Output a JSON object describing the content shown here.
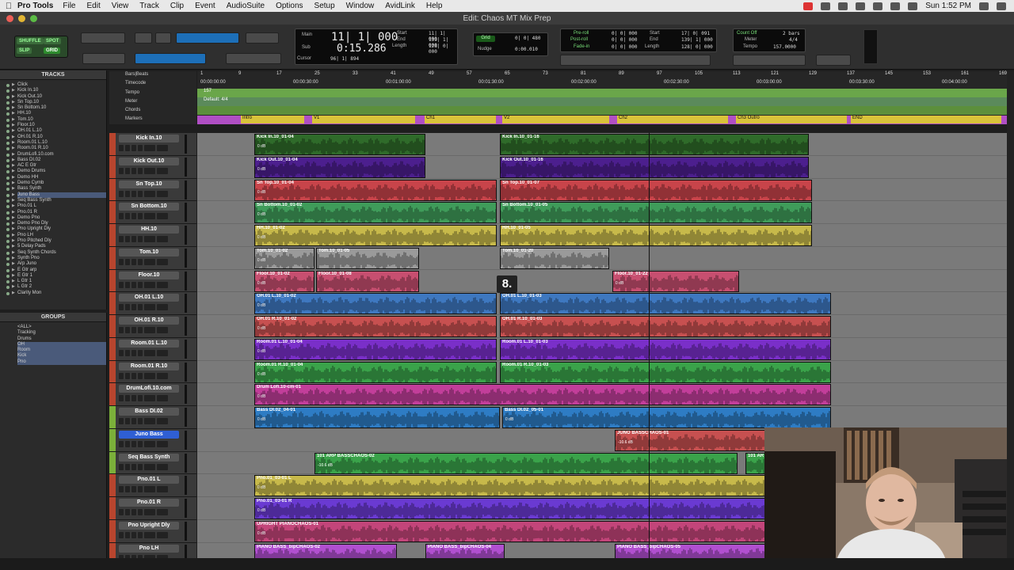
{
  "menubar": {
    "apple": "",
    "app": "Pro Tools",
    "items": [
      "File",
      "Edit",
      "View",
      "Track",
      "Clip",
      "Event",
      "AudioSuite",
      "Options",
      "Setup",
      "Window",
      "AvidLink",
      "Help"
    ],
    "clock": "Sun 1:52 PM"
  },
  "window": {
    "title": "Edit: Chaos MT Mix Prep"
  },
  "toolbar": {
    "mode_shuffle": "SHUFFLE",
    "mode_spot": "SPOT",
    "mode_slip": "SLIP",
    "mode_grid": "GRID",
    "counter_main_label": "Main",
    "counter_main_value": "11| 1| 000",
    "counter_sub_label": "Sub",
    "counter_sub_value": "0:15.286",
    "start_label": "Start",
    "start_value": "11| 1| 000",
    "end_label": "End",
    "end_value": "139| 1| 000",
    "length_label": "Length",
    "length_value": "128| 0| 000",
    "cursor_label": "Cursor",
    "cursor_value": "96| 1| 894",
    "grid_label": "Grid",
    "grid_value": "0| 0| 480",
    "nudge_label": "Nudge",
    "nudge_value": "0:00.010",
    "preroll_label": "Pre-roll",
    "preroll_value": "0| 0| 000",
    "postroll_label": "Post-roll",
    "postroll_value": "0| 0| 000",
    "fadein_label": "Fade-in",
    "fadein_value": "0| 0| 000",
    "start2_value": "17| 0| 091",
    "end2_value": "139| 1| 000",
    "length2_value": "128| 0| 000",
    "countoff_label": "Count Off",
    "countoff_value": "2 bars",
    "meter_label": "Meter",
    "meter_value": "4/4",
    "tempo_label": "Tempo",
    "tempo_value": "157.0000"
  },
  "tracks_panel": {
    "title": "TRACKS",
    "items": [
      "Click",
      "Kick In.10",
      "Kick Out.10",
      "Sn Top.10",
      "Sn Bottom.10",
      "HH.10",
      "Tom.10",
      "Floor.10",
      "OH.01 L.10",
      "OH.01 R.10",
      "Room.01 L.10",
      "Room.01 R.10",
      "DrumLofi.10.com",
      "Bass DI.02",
      "AC E Gtr",
      "Demo Drums",
      "Demo HH",
      "Demo Cymb",
      "Bass Synth",
      "Juno Bass",
      "Seq Bass Synth",
      "Pno.01 L",
      "Pno.01 R",
      "Demo Pno",
      "Demo Pno Dly",
      "Pno Upright Dly",
      "Pno LH",
      "Pno Pitched Dly",
      "5 Delay Pads",
      "Seq Synth Chords",
      "Synth Pno",
      "Arp Juno",
      "E Gtr arp",
      "E Gtr 1",
      "L Gtr 1",
      "L Gtr 2",
      "Clarity Mon"
    ]
  },
  "groups_panel": {
    "title": "GROUPS",
    "items": [
      "<ALL>",
      "Tracking",
      "Drums",
      "OH",
      "Room",
      "Kick",
      "Pno"
    ]
  },
  "rulers": {
    "labels": [
      "Bars|Beats",
      "Timecode",
      "Tempo",
      "Meter",
      "Chords",
      "Markers"
    ],
    "bars": [
      "1",
      "9",
      "17",
      "25",
      "33",
      "41",
      "49",
      "57",
      "65",
      "73",
      "81",
      "89",
      "97",
      "105",
      "113",
      "121",
      "129",
      "137",
      "145",
      "153",
      "161",
      "169"
    ],
    "timecodes": [
      "00:00:00:00",
      "00:00:30:00",
      "00:01:00:00",
      "00:01:30:00",
      "00:02:00:00",
      "00:02:30:00",
      "00:03:00:00",
      "00:03:30:00",
      "00:04:00:00"
    ],
    "tempo": "157",
    "meter": "Default: 4/4",
    "markers": [
      "Intro",
      "V1",
      "Ch1",
      "V2",
      "Ch2",
      "Ch3 Outro",
      "END"
    ]
  },
  "tracks": [
    {
      "name": "Kick In.10",
      "clips": [
        {
          "n": "Kick In.10_01-04",
          "g": "0 dB"
        },
        {
          "n": "Kick In.10_01-16",
          "g": ""
        }
      ]
    },
    {
      "name": "Kick Out.10",
      "clips": [
        {
          "n": "Kick Out.10_01-04",
          "g": "0 dB"
        },
        {
          "n": "Kick Out.10_01-16",
          "g": ""
        }
      ]
    },
    {
      "name": "Sn Top.10",
      "clips": [
        {
          "n": "Sn Top.10_01-04",
          "g": "0 dB"
        },
        {
          "n": "Sn Top.10_01-07",
          "g": ""
        }
      ]
    },
    {
      "name": "Sn Bottom.10",
      "clips": [
        {
          "n": "Sn Bottom.10_01-02",
          "g": "0 dB"
        },
        {
          "n": "Sn Bottom.10_01-05",
          "g": ""
        }
      ]
    },
    {
      "name": "HH.10",
      "clips": [
        {
          "n": "HH.10_01-02",
          "g": "0 dB"
        },
        {
          "n": "HH.10_01-05",
          "g": ""
        }
      ]
    },
    {
      "name": "Tom.10",
      "clips": [
        {
          "n": "Tom.10_01-02",
          "g": "0 dB"
        },
        {
          "n": "Tom.10_01-05",
          "g": ""
        },
        {
          "n": "Tom.10_01-20",
          "g": ""
        }
      ]
    },
    {
      "name": "Floor.10",
      "clips": [
        {
          "n": "Floor.10_01-02",
          "g": "0 dB"
        },
        {
          "n": "Floor.10_01-08",
          "g": ""
        },
        {
          "n": "Floor.10_01-22",
          "g": "0 dB"
        }
      ]
    },
    {
      "name": "OH.01 L.10",
      "clips": [
        {
          "n": "OH.01 L.10_01-02",
          "g": "0 dB"
        },
        {
          "n": "OH.01 L.10_01-03",
          "g": ""
        }
      ]
    },
    {
      "name": "OH.01 R.10",
      "clips": [
        {
          "n": "OH.01 R.10_01-02",
          "g": "0 dB"
        },
        {
          "n": "OH.01 R.10_01-03",
          "g": ""
        }
      ]
    },
    {
      "name": "Room.01 L.10",
      "clips": [
        {
          "n": "Room.01 L.10_01-04",
          "g": "0 dB"
        },
        {
          "n": "Room.01 L.10_01-03",
          "g": ""
        }
      ]
    },
    {
      "name": "Room.01 R.10",
      "clips": [
        {
          "n": "Room.01 R.10_01-04",
          "g": "0 dB"
        },
        {
          "n": "Room.01 R.10_01-03",
          "g": ""
        }
      ]
    },
    {
      "name": "DrumLofi.10.com",
      "clips": [
        {
          "n": "Drum Lofi.10-cm-01",
          "g": "0 dB"
        }
      ]
    },
    {
      "name": "Bass DI.02",
      "clips": [
        {
          "n": "Bass DI.02_04-01",
          "g": "0 dB"
        },
        {
          "n": "Bass DI.02_05-01",
          "g": "0 dB"
        }
      ]
    },
    {
      "name": "Juno Bass",
      "clips": [
        {
          "n": "JUNO BASSCHAOS-01",
          "g": "-10.6 dB"
        }
      ]
    },
    {
      "name": "Seq Bass Synth",
      "clips": [
        {
          "n": "101 ARP BASSCHAOS-02",
          "g": "-10.6 dB"
        },
        {
          "n": "101 AR",
          "g": ""
        }
      ]
    },
    {
      "name": "Pno.01 L",
      "clips": [
        {
          "n": "Pno.01_03-01 L",
          "g": "0 dB"
        }
      ]
    },
    {
      "name": "Pno.01 R",
      "clips": [
        {
          "n": "Pno.01_03-01 R",
          "g": "0 dB"
        }
      ]
    },
    {
      "name": "Pno Upright Dly",
      "clips": [
        {
          "n": "UPRIGHT PIANOCHAOS-01",
          "g": "0 dB"
        }
      ]
    },
    {
      "name": "Pno LH",
      "clips": [
        {
          "n": "PIANO BASS_bipCHAOS-02",
          "g": ""
        },
        {
          "n": "PIANO BASS_bipCHAOS-04",
          "g": ""
        },
        {
          "n": "PIANO BASS_bipCHAOS-05",
          "g": ""
        }
      ]
    }
  ],
  "overlay_number": "8.",
  "colors": {
    "kick_in": "#2f6b2a",
    "kick_out": "#4c1f8e",
    "sn_top": "#c8444a",
    "sn_bottom": "#3f9c5a",
    "hh": "#c7b94a",
    "tom": "#9a9a9a",
    "floor": "#c74f70",
    "oh_l": "#3e78c0",
    "oh_r": "#c75050",
    "room_l": "#7a2fc9",
    "room_r": "#3aa34a",
    "drumlofi": "#c23e9a",
    "bass_di": "#2e7cc4",
    "juno": "#c75050",
    "seq": "#3aa34a",
    "pno_l": "#c7b94a",
    "pno_r": "#6a3ad2",
    "pno_up": "#c3457a",
    "pno_lh": "#b14fd0"
  }
}
